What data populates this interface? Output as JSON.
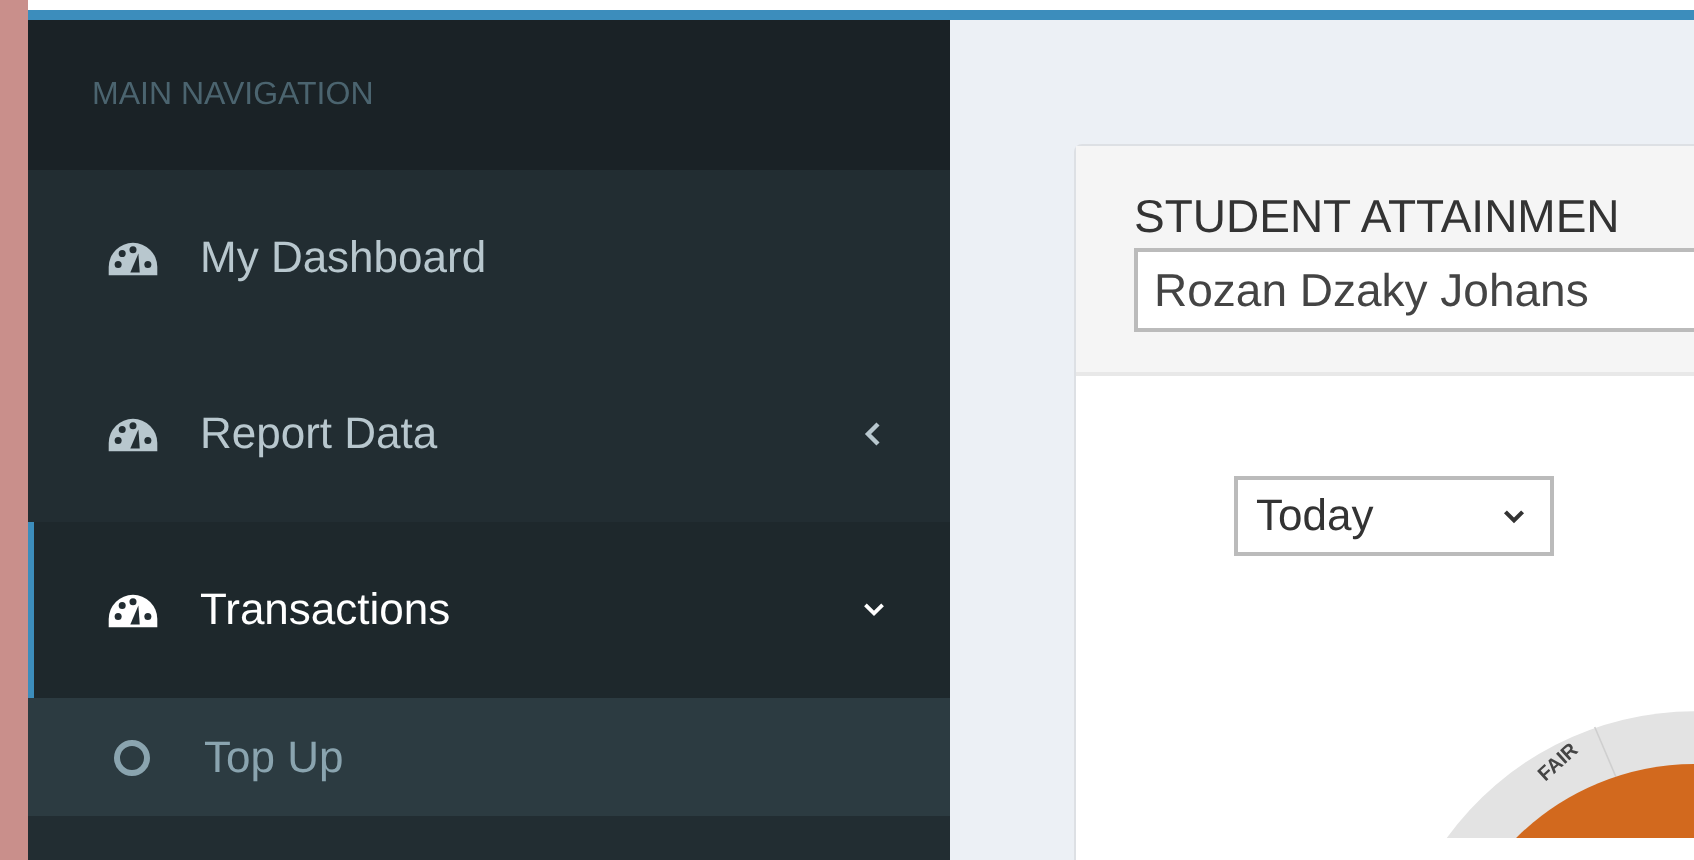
{
  "sidebar": {
    "header": "MAIN NAVIGATION",
    "items": [
      {
        "label": "My Dashboard",
        "submenu": false,
        "selected": false
      },
      {
        "label": "Report Data",
        "submenu": true,
        "selected": false,
        "expanded": false
      },
      {
        "label": "Transactions",
        "submenu": true,
        "selected": true,
        "expanded": true,
        "children": [
          {
            "label": "Top Up",
            "selected": false
          }
        ]
      }
    ]
  },
  "card": {
    "title": "STUDENT ATTAINMEN",
    "student": "Rozan Dzaky Johans",
    "period": "Today",
    "gauge": {
      "band_label": "FAIR"
    }
  }
}
